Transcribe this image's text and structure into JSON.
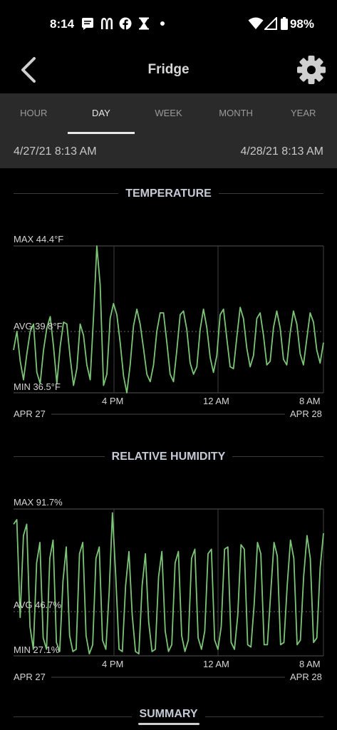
{
  "status_bar": {
    "time": "8:14",
    "battery": "98%",
    "notification_icons": [
      "message-icon",
      "mcdonalds-icon",
      "facebook-icon",
      "hourglass-icon",
      "dot-icon"
    ]
  },
  "header": {
    "title": "Fridge"
  },
  "tabs": [
    {
      "label": "HOUR",
      "active": false
    },
    {
      "label": "DAY",
      "active": true
    },
    {
      "label": "WEEK",
      "active": false
    },
    {
      "label": "MONTH",
      "active": false
    },
    {
      "label": "YEAR",
      "active": false
    }
  ],
  "date_range": {
    "start": "4/27/21 8:13 AM",
    "end": "4/28/21 8:13 AM"
  },
  "temperature": {
    "section_title": "TEMPERATURE",
    "max_label": "MAX 44.4°F",
    "avg_label": "AVG 39.8°F",
    "min_label": "MIN 36.5°F",
    "x_ticks": [
      "4 PM",
      "12 AM",
      "8 AM"
    ],
    "start_day": "APR 27",
    "end_day": "APR 28",
    "line_color": "#7cc576"
  },
  "humidity": {
    "section_title": "RELATIVE HUMIDITY",
    "max_label": "MAX 91.7%",
    "avg_label": "AVG 46.7%",
    "min_label": "MIN 27.1%",
    "x_ticks": [
      "4 PM",
      "12 AM",
      "8 AM"
    ],
    "start_day": "APR 27",
    "end_day": "APR 28",
    "line_color": "#7cc576"
  },
  "summary": {
    "section_title": "SUMMARY"
  },
  "chart_data": [
    {
      "type": "line",
      "title": "TEMPERATURE",
      "unit": "°F",
      "ylim": [
        36.5,
        44.4
      ],
      "avg": 39.8,
      "x_ticks": [
        "4 PM",
        "12 AM",
        "8 AM"
      ],
      "x_range": [
        "APR 27",
        "APR 28"
      ],
      "series": [
        {
          "values": [
            38.8,
            39.8,
            38.2,
            37.2,
            38.6,
            39.8,
            40.2,
            37.6,
            37.0,
            38.8,
            40.0,
            40.6,
            39.0,
            37.0,
            39.0,
            40.3,
            40.2,
            38.4,
            36.9,
            37.8,
            40.2,
            39.6,
            38.0,
            37.2,
            40.6,
            44.4,
            42.3,
            36.9,
            37.5,
            40.5,
            41.3,
            40.7,
            39.2,
            37.4,
            36.5,
            38.0,
            40.1,
            41.0,
            40.2,
            38.9,
            37.5,
            37.1,
            38.0,
            39.8,
            40.8,
            40.8,
            39.2,
            37.5,
            37.1,
            38.8,
            40.7,
            40.9,
            39.9,
            38.1,
            37.5,
            37.9,
            39.9,
            41.0,
            40.0,
            38.4,
            37.6,
            38.5,
            40.7,
            41.0,
            39.4,
            37.9,
            37.8,
            39.5,
            41.1,
            40.5,
            38.9,
            37.9,
            38.5,
            40.5,
            40.8,
            39.6,
            38.0,
            38.2,
            40.0,
            40.9,
            40.0,
            38.3,
            38.0,
            39.7,
            40.9,
            40.2,
            38.6,
            38.0,
            39.4,
            40.8,
            40.3,
            38.8,
            38.1,
            39.2
          ]
        }
      ]
    },
    {
      "type": "line",
      "title": "RELATIVE HUMIDITY",
      "unit": "%",
      "ylim": [
        27.1,
        91.7
      ],
      "avg": 46.7,
      "x_ticks": [
        "4 PM",
        "12 AM",
        "8 AM"
      ],
      "x_range": [
        "APR 27",
        "APR 28"
      ],
      "series": [
        {
          "values": [
            85,
            87,
            44,
            80,
            85,
            40,
            30,
            68,
            77,
            35,
            30,
            70,
            78,
            33,
            29,
            60,
            75,
            36,
            29,
            30,
            72,
            77,
            36,
            28,
            32,
            70,
            75,
            34,
            30,
            55,
            90,
            62,
            30,
            29,
            58,
            73,
            45,
            29,
            28,
            58,
            72,
            42,
            29,
            30,
            62,
            73,
            38,
            29,
            32,
            68,
            73,
            36,
            29,
            34,
            70,
            74,
            35,
            30,
            38,
            72,
            74,
            34,
            30,
            40,
            74,
            75,
            33,
            30,
            45,
            76,
            74,
            32,
            31,
            50,
            77,
            72,
            32,
            32,
            55,
            77,
            71,
            32,
            33,
            58,
            78,
            70,
            32,
            34,
            62,
            80,
            70,
            33,
            35,
            66,
            81
          ]
        }
      ]
    }
  ]
}
